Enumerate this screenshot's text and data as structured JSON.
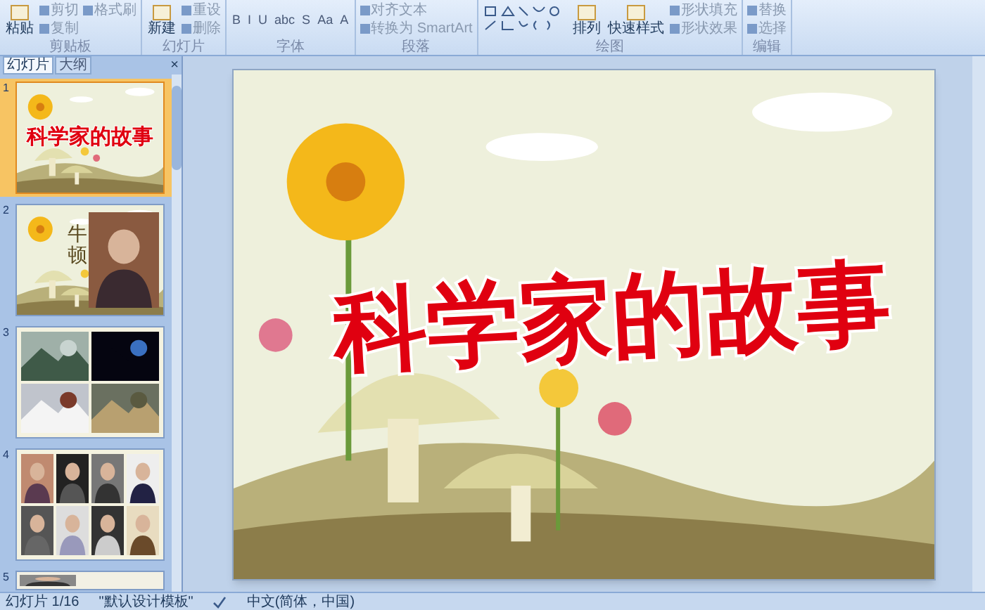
{
  "ribbon": {
    "groups": [
      {
        "label": "剪贴板",
        "items": [
          {
            "kind": "large",
            "text": "粘贴"
          },
          {
            "kind": "small",
            "text": "剪切"
          },
          {
            "kind": "small",
            "text": "复制"
          },
          {
            "kind": "small",
            "text": "格式刷"
          }
        ]
      },
      {
        "label": "幻灯片",
        "items": [
          {
            "kind": "large",
            "text": "新建"
          },
          {
            "kind": "small",
            "text": "重设"
          },
          {
            "kind": "small",
            "text": "删除"
          }
        ]
      },
      {
        "label": "字体",
        "items": [
          {
            "kind": "glyph",
            "text": "B"
          },
          {
            "kind": "glyph",
            "text": "I"
          },
          {
            "kind": "glyph",
            "text": "U"
          },
          {
            "kind": "glyph",
            "text": "abc"
          },
          {
            "kind": "glyph",
            "text": "S"
          },
          {
            "kind": "glyph",
            "text": "Aa"
          },
          {
            "kind": "glyph",
            "text": "A"
          }
        ]
      },
      {
        "label": "段落",
        "items": [
          {
            "kind": "small",
            "text": "对齐文本"
          },
          {
            "kind": "small",
            "text": "转换为 SmartArt"
          }
        ]
      },
      {
        "label": "绘图",
        "items": [
          {
            "kind": "shapes"
          },
          {
            "kind": "large",
            "text": "排列"
          },
          {
            "kind": "large",
            "text": "快速样式"
          },
          {
            "kind": "small",
            "text": "形状填充"
          },
          {
            "kind": "small",
            "text": "形状效果"
          }
        ]
      },
      {
        "label": "编辑",
        "items": [
          {
            "kind": "small",
            "text": "替换"
          },
          {
            "kind": "small",
            "text": "选择"
          }
        ]
      }
    ]
  },
  "pane": {
    "tabs": [
      {
        "label": "幻灯片",
        "selected": true
      },
      {
        "label": "大纲",
        "selected": false
      }
    ],
    "close": "×"
  },
  "slides": [
    {
      "number": "1",
      "selected": true,
      "kind": "title",
      "title": "科学家的故事"
    },
    {
      "number": "2",
      "selected": false,
      "kind": "portrait",
      "title": "牛顿"
    },
    {
      "number": "3",
      "selected": false,
      "kind": "photos"
    },
    {
      "number": "4",
      "selected": false,
      "kind": "people"
    },
    {
      "number": "5",
      "selected": false,
      "kind": "partial"
    }
  ],
  "slide": {
    "title": "科学家的故事"
  },
  "status_bar": {
    "slide": "幻灯片 1/16",
    "theme": "\"默认设计模板\"",
    "language": "中文(简体，中国)"
  }
}
